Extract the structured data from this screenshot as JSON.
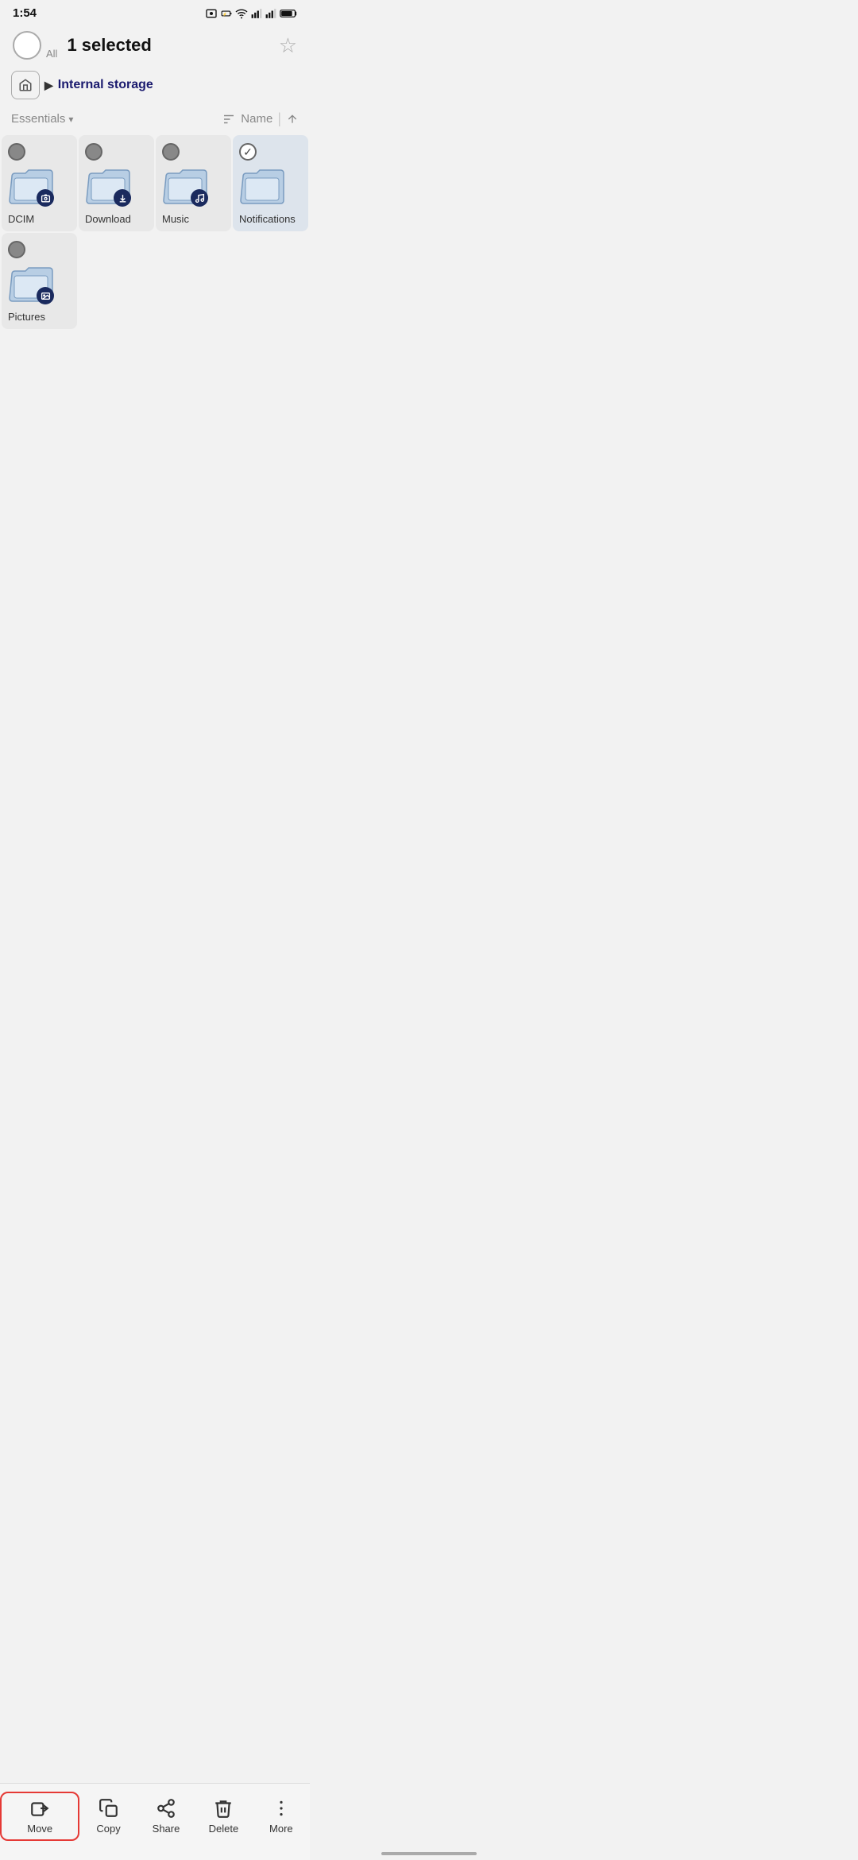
{
  "statusBar": {
    "time": "1:54",
    "icons": [
      "photo",
      "battery-low",
      "wifi",
      "signal1",
      "signal2",
      "battery"
    ]
  },
  "header": {
    "selectAllLabel": "All",
    "selectedText": "1 selected",
    "starIcon": "☆"
  },
  "breadcrumb": {
    "homeIcon": "🏠",
    "arrow": "▶",
    "path": "Internal storage"
  },
  "toolbar": {
    "filterLabel": "Essentials",
    "sortLabel": "Name"
  },
  "folders": [
    {
      "id": "dcim",
      "name": "DCIM",
      "badge": "camera",
      "selected": false
    },
    {
      "id": "download",
      "name": "Download",
      "badge": "download",
      "selected": false
    },
    {
      "id": "music",
      "name": "Music",
      "badge": "music",
      "selected": false
    },
    {
      "id": "notifications",
      "name": "Notifications",
      "badge": "folder",
      "selected": true
    },
    {
      "id": "pictures",
      "name": "Pictures",
      "badge": "image",
      "selected": false
    }
  ],
  "actionBar": {
    "move": "Move",
    "copy": "Copy",
    "share": "Share",
    "delete": "Delete",
    "more": "More"
  }
}
